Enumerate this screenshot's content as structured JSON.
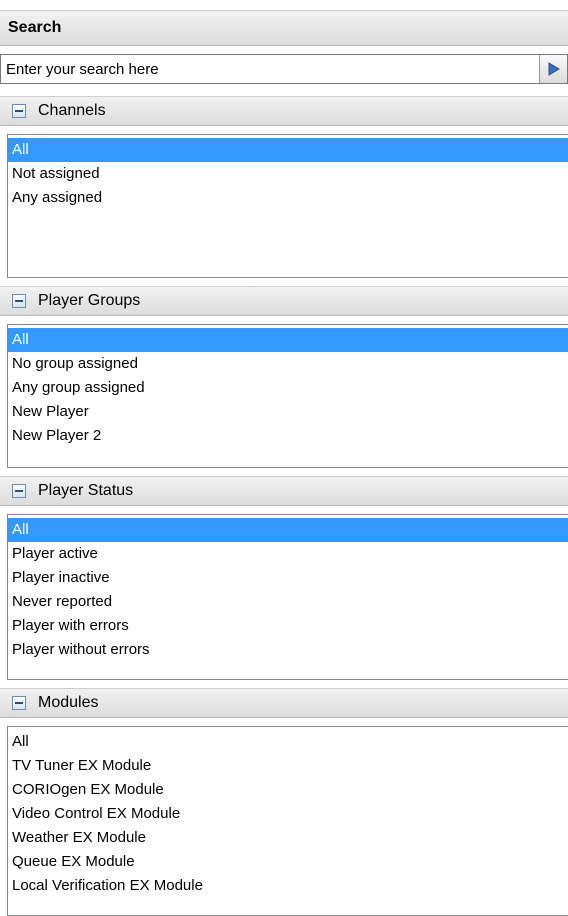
{
  "search": {
    "title": "Search",
    "placeholder": "Enter your search here"
  },
  "sections": [
    {
      "title": "Channels",
      "items": [
        {
          "label": "All",
          "selected": true
        },
        {
          "label": "Not assigned",
          "selected": false
        },
        {
          "label": "Any assigned",
          "selected": false
        }
      ]
    },
    {
      "title": "Player Groups",
      "items": [
        {
          "label": "All",
          "selected": true
        },
        {
          "label": "No group assigned",
          "selected": false
        },
        {
          "label": "Any group assigned",
          "selected": false
        },
        {
          "label": "New Player",
          "selected": false
        },
        {
          "label": "New Player 2",
          "selected": false
        }
      ]
    },
    {
      "title": "Player Status",
      "items": [
        {
          "label": "All",
          "selected": true
        },
        {
          "label": "Player active",
          "selected": false
        },
        {
          "label": "Player inactive",
          "selected": false
        },
        {
          "label": "Never reported",
          "selected": false
        },
        {
          "label": "Player with errors",
          "selected": false
        },
        {
          "label": "Player without errors",
          "selected": false
        }
      ]
    },
    {
      "title": "Modules",
      "items": [
        {
          "label": "All",
          "selected": false
        },
        {
          "label": "TV Tuner EX Module",
          "selected": false
        },
        {
          "label": "CORIOgen EX Module",
          "selected": false
        },
        {
          "label": "Video Control EX Module",
          "selected": false
        },
        {
          "label": "Weather EX Module",
          "selected": false
        },
        {
          "label": "Queue EX Module",
          "selected": false
        },
        {
          "label": "Local Verification EX Module",
          "selected": false
        }
      ]
    }
  ],
  "icons": {
    "go": "play-arrow-icon",
    "collapse": "collapse-minus-icon"
  },
  "colors": {
    "selection": "#3399ff",
    "selection_text": "#ffffff"
  }
}
